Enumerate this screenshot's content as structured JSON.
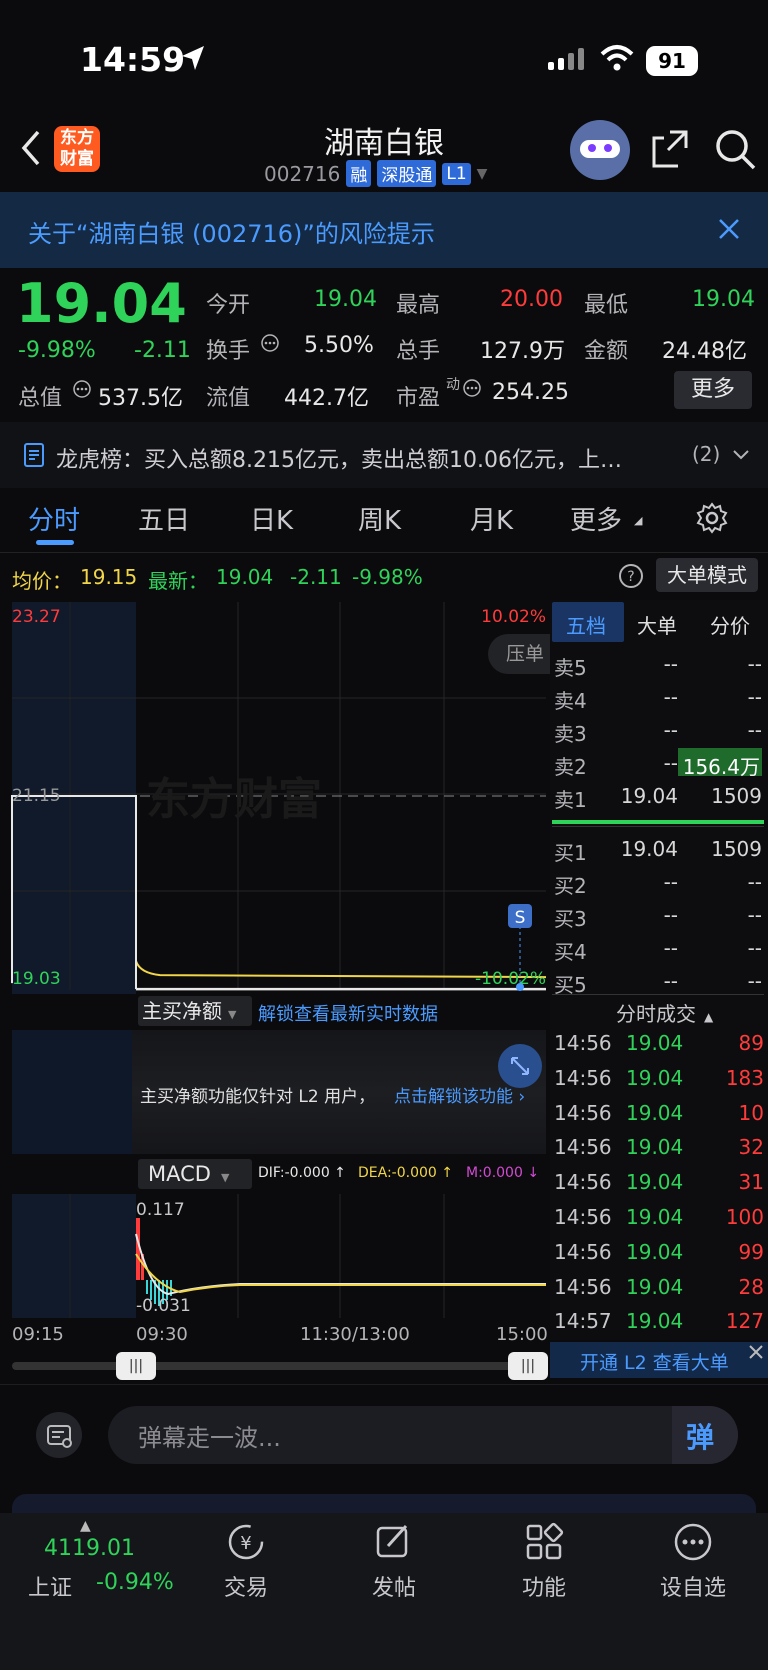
{
  "status_bar": {
    "time": "14:59",
    "battery": "91"
  },
  "header": {
    "title": "湖南白银",
    "code": "002716",
    "tags": [
      "融",
      "深股通",
      "L1"
    ],
    "logo_text": "东方财富"
  },
  "risk_banner": {
    "text": "关于“湖南白银 (002716)”的风险提示"
  },
  "quote": {
    "price": "19.04",
    "change_pct": "-9.98%",
    "change_abs": "-2.11",
    "open_label": "今开",
    "open": "19.04",
    "high_label": "最高",
    "high": "20.00",
    "low_label": "最低",
    "low": "19.04",
    "turnover_label": "换手",
    "turnover": "5.50%",
    "volume_label": "总手",
    "volume": "127.9万",
    "amount_label": "金额",
    "amount": "24.48亿",
    "mktcap_label": "总值",
    "mktcap": "537.5亿",
    "float_label": "流值",
    "float": "442.7亿",
    "pe_label": "市盈",
    "pe_sup": "动",
    "pe": "254.25",
    "more_button": "更多"
  },
  "dragon_tiger": {
    "text": "龙虎榜：买入总额8.215亿元，卖出总额10.06亿元，上…",
    "count": "(2)"
  },
  "tabs": [
    "分时",
    "五日",
    "日K",
    "周K",
    "月K",
    "更多"
  ],
  "info_row": {
    "avg_label": "均价：",
    "avg": "19.15",
    "latest_label": "最新：",
    "latest": "19.04",
    "latest_chg": "-2.11",
    "latest_pct": "-9.98%",
    "mode_button": "大单模式"
  },
  "chart_data": {
    "type": "line",
    "y_max_label": "23.27",
    "y_max_pct": "10.02%",
    "y_min_label": "19.03",
    "y_min_pct": "-10.02%",
    "ref_label": "21.15",
    "watermark": "东方财富",
    "x_labels": [
      "09:15",
      "09:30",
      "11:30/13:00",
      "15:00"
    ],
    "price_series_open": 19.04,
    "price_series_close": 19.04,
    "sell_marker": "S",
    "overlay_button": "压单"
  },
  "flow_panel": {
    "dropdown": "主买净额",
    "unlock_link": "解锁查看最新实时数据",
    "notice": "主买净额功能仅针对 L2 用户，",
    "notice_link": "点击解锁该功能"
  },
  "macd_panel": {
    "dropdown": "MACD",
    "dif": "DIF:-0.000 ↑",
    "dea": "DEA:-0.000 ↑",
    "m": "M:0.000 ↓",
    "top_label": "0.117",
    "bottom_label": "-0.031"
  },
  "orderbook": {
    "tabs": [
      "五档",
      "大单",
      "分价"
    ],
    "sells": [
      {
        "label": "卖5",
        "price": "--",
        "vol": "--"
      },
      {
        "label": "卖4",
        "price": "--",
        "vol": "--"
      },
      {
        "label": "卖3",
        "price": "--",
        "vol": "--"
      },
      {
        "label": "卖2",
        "price": "--",
        "vol": "156.4万"
      },
      {
        "label": "卖1",
        "price": "19.04",
        "vol": "1509"
      }
    ],
    "buys": [
      {
        "label": "买1",
        "price": "19.04",
        "vol": "1509"
      },
      {
        "label": "买2",
        "price": "--",
        "vol": "--"
      },
      {
        "label": "买3",
        "price": "--",
        "vol": "--"
      },
      {
        "label": "买4",
        "price": "--",
        "vol": "--"
      },
      {
        "label": "买5",
        "price": "--",
        "vol": "--"
      }
    ],
    "trades_title": "分时成交",
    "trades": [
      {
        "time": "14:56",
        "price": "19.04",
        "vol": "89"
      },
      {
        "time": "14:56",
        "price": "19.04",
        "vol": "183"
      },
      {
        "time": "14:56",
        "price": "19.04",
        "vol": "10"
      },
      {
        "time": "14:56",
        "price": "19.04",
        "vol": "32"
      },
      {
        "time": "14:56",
        "price": "19.04",
        "vol": "31"
      },
      {
        "time": "14:56",
        "price": "19.04",
        "vol": "100"
      },
      {
        "time": "14:56",
        "price": "19.04",
        "vol": "99"
      },
      {
        "time": "14:56",
        "price": "19.04",
        "vol": "28"
      },
      {
        "time": "14:57",
        "price": "19.04",
        "vol": "127"
      }
    ],
    "l2_button": "开通 L2 查看大单"
  },
  "danmaku": {
    "placeholder": "弹幕走一波...",
    "send": "弹"
  },
  "bottom_nav": {
    "index_value": "4119.01",
    "index_name": "上证",
    "index_pct": "-0.94%",
    "items": [
      "交易",
      "发帖",
      "功能",
      "设自选"
    ]
  }
}
